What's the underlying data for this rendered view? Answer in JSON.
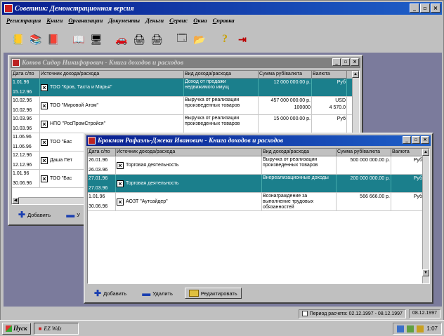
{
  "app": {
    "title": "Советник: Демонстрационная версия",
    "window_buttons": [
      "_",
      "▫",
      "×"
    ]
  },
  "menu": [
    "Регистрация",
    "Книги",
    "Организации",
    "Документы",
    "Деньги",
    "Сервис",
    "Окна",
    "Справка"
  ],
  "toolbar": {
    "icons": [
      "open-book-icon",
      "books-icon",
      "ledger-icon",
      "book-open-icon",
      "monitor-icon",
      "car-icon",
      "printer-icon",
      "printer-setup-icon",
      "window-icon",
      "folder-icon",
      "help-icon",
      "exit-icon"
    ],
    "glyphs": [
      "📒",
      "📚",
      "📕",
      "📖",
      "🖥",
      "🚗",
      "🖨",
      "🖨",
      "🗔",
      "📂",
      "?",
      "⇥"
    ]
  },
  "window1": {
    "title": "Котов Сидор Никифорович - Книга доходов и расходов",
    "columns": [
      "Дата с/по",
      "Источник дохода/расхода",
      "Вид дохода/расхода",
      "Сумма руб/валюта",
      "Валюта"
    ],
    "rows": [
      {
        "date_from": "1.01.96",
        "date_to": "15.12.96",
        "source": "ТОО \"Кров, Тахта и Марья\"",
        "type": "Доход от продажи недвижимого имущ",
        "amount": "12 000 000.00 р.",
        "amount2": "",
        "currency": "Руб"
      },
      {
        "date_from": "10.02.96",
        "date_to": "10.02.96",
        "source": "ТОО \"Мировой Атом\"",
        "type": "Выручка от реализации произведенных товаров",
        "amount": "457 000 000.00 р.",
        "amount2": "100000",
        "currency": "USD",
        "currency2": "4 570.0"
      },
      {
        "date_from": "10.03.96",
        "date_to": "10.03.96",
        "source": "НПО \"РосПромСтройся\"",
        "type": "Выручка от реализации произведенных товаров",
        "amount": "15 000 000.00 р.",
        "amount2": "",
        "currency": "Руб"
      },
      {
        "date_from": "11.06.96",
        "date_to": "11.06.96",
        "source": "ТОО \"Бас",
        "type": "",
        "amount": "",
        "amount2": "",
        "currency": ""
      },
      {
        "date_from": "12.12.96",
        "date_to": "12.12.96",
        "source": "Даша Пет",
        "type": "",
        "amount": "",
        "amount2": "",
        "currency": ""
      },
      {
        "date_from": "1.01.96",
        "date_to": "30.06.96",
        "source": "ТОО \"Бас",
        "type": "",
        "amount": "",
        "amount2": "",
        "currency": ""
      }
    ],
    "add_label": "Добавить",
    "delete_label": "У"
  },
  "window2": {
    "title": "Брокман Рафаэль-Джеки Иванович - Книга доходов и расходов",
    "columns": [
      "Дата с/по",
      "Источник дохода/расхода",
      "Вид дохода/расхода",
      "Сумма руб/валюта",
      "Валюта"
    ],
    "rows": [
      {
        "date_from": "26.01.96",
        "date_to": "26.03.96",
        "source": "Торговая деятельность",
        "type": "Выручка от реализации произведенных товаров",
        "amount": "500 000 000.00 р.",
        "currency": "Руб"
      },
      {
        "date_from": "27.01.96",
        "date_to": "27.03.96",
        "source": "Торговая деятельность",
        "type": "Внереализационные доходы",
        "amount": "200 000 000.00 р.",
        "currency": "Руб"
      },
      {
        "date_from": "1.01.96",
        "date_to": "30.06.96",
        "source": "АОЗТ \"Аутсайдер\"",
        "type": "Вознаграждение за выполнение трудовых обязанностей",
        "amount": "566 666.00 р.",
        "currency": "Руб"
      }
    ],
    "add_label": "Добавить",
    "delete_label": "Удалить",
    "edit_label": "Редактировать"
  },
  "status": {
    "period": "Период расчета: 02.12.1997 - 08.12.1997",
    "date": "08.12.1997"
  },
  "taskbar": {
    "start_label": "Пуск",
    "task_label": "EZ Wdz",
    "clock": "1:07"
  }
}
